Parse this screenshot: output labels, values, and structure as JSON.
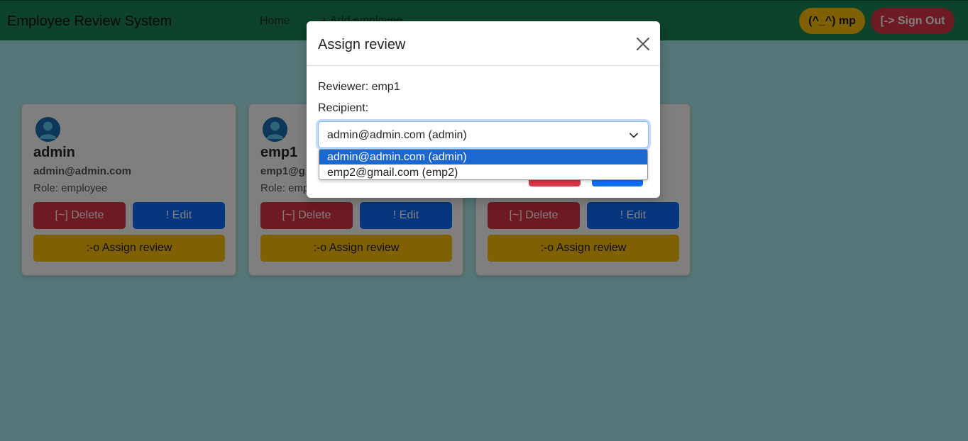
{
  "navbar": {
    "brand": "Employee Review System",
    "links": [
      "Home",
      "+ Add employee"
    ],
    "user_badge": "(^_^) mp",
    "signout_label": "[-> Sign Out"
  },
  "cards": [
    {
      "name": "admin",
      "email": "admin@admin.com",
      "role": "Role: employee",
      "delete_label": "[~] Delete",
      "edit_label": "! Edit",
      "assign_label": ":-o Assign review"
    },
    {
      "name": "emp1",
      "email": "emp1@g",
      "role": "Role: emp",
      "delete_label": "[~] Delete",
      "edit_label": "! Edit",
      "assign_label": ":-o Assign review"
    },
    {
      "name": "",
      "email": "",
      "role": "",
      "delete_label": "[~] Delete",
      "edit_label": "! Edit",
      "assign_label": ":-o Assign review"
    }
  ],
  "modal": {
    "title": "Assign review",
    "reviewer": "Reviewer: emp1",
    "recipient_label": "Recipient:",
    "selected": "admin@admin.com (admin)",
    "options": [
      "admin@admin.com (admin)",
      "emp2@gmail.com (emp2)"
    ]
  },
  "colors": {
    "navbar": "#198754",
    "page_bg": "#adefef",
    "danger": "#dc3545",
    "primary": "#0d6efd",
    "warning": "#ffc107",
    "option_highlight": "#1c68d3"
  }
}
